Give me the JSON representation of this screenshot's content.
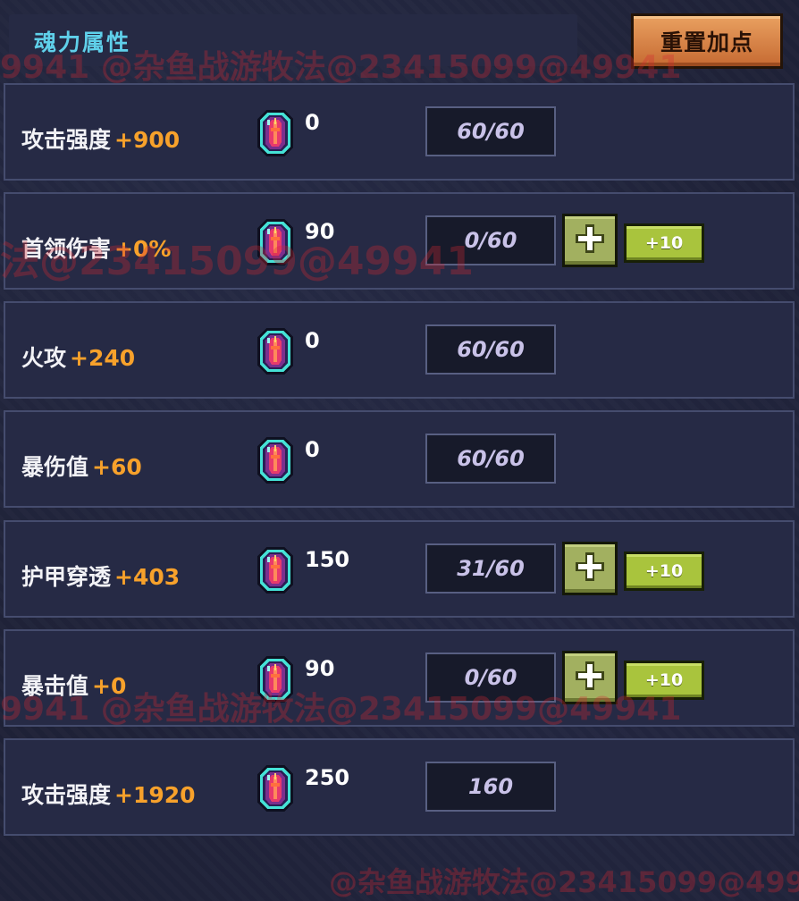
{
  "header": {
    "title": "魂力属性",
    "reset_label": "重置加点"
  },
  "colors": {
    "title": "#5fd0ea",
    "bonus": "#f7a12b",
    "reset_button": "#d98548",
    "plus_button": "#a2b060",
    "plus_ten_button": "#a9c43d"
  },
  "icons": {
    "cost": "soul-crystal-icon",
    "add": "plus-icon"
  },
  "rows": [
    {
      "name": "攻击强度",
      "bonus": "+900",
      "cost": "0",
      "level": "60/60",
      "can_add": false
    },
    {
      "name": "首领伤害",
      "bonus": "+0%",
      "cost": "90",
      "level": "0/60",
      "can_add": true,
      "add_ten_label": "+10"
    },
    {
      "name": "火攻",
      "bonus": "+240",
      "cost": "0",
      "level": "60/60",
      "can_add": false
    },
    {
      "name": "暴伤值",
      "bonus": "+60",
      "cost": "0",
      "level": "60/60",
      "can_add": false
    },
    {
      "name": "护甲穿透",
      "bonus": "+403",
      "cost": "150",
      "level": "31/60",
      "can_add": true,
      "add_ten_label": "+10"
    },
    {
      "name": "暴击值",
      "bonus": "+0",
      "cost": "90",
      "level": "0/60",
      "can_add": true,
      "add_ten_label": "+10"
    },
    {
      "name": "攻击强度",
      "bonus": "+1920",
      "cost": "250",
      "level": "160",
      "can_add": false
    }
  ],
  "watermarks": [
    "9941  @杂鱼战游牧法@23415099@49941",
    "法@23415099@49941",
    "9941  @杂鱼战游牧法@23415099@49941",
    "@杂鱼战游牧法@23415099@4994"
  ]
}
